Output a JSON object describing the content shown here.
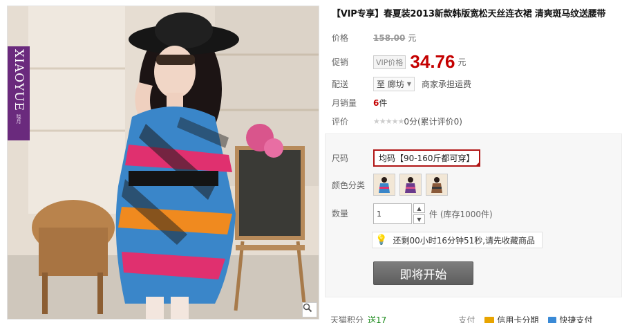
{
  "product": {
    "title": "【VIP专享】春夏装2013新款韩版宽松天丝连衣裙 清爽斑马纹送腰带",
    "brand_name": "XIAOYUE",
    "brand_sub": "晓月"
  },
  "price_row": {
    "label": "价格",
    "original": "158.00",
    "unit": "元"
  },
  "promo_row": {
    "label": "促销",
    "tag": "VIP价格",
    "price": "34.76",
    "unit": "元"
  },
  "delivery_row": {
    "label": "配送",
    "location": "至 廊坊",
    "note": "商家承担运费"
  },
  "sales_row": {
    "label": "月销量",
    "count": "6",
    "unit": "件"
  },
  "rating_row": {
    "label": "评价",
    "stars": "★★★★★",
    "text": "0分(累计评价0)"
  },
  "size_row": {
    "label": "尺码",
    "selected": "均码【90-160斤都可穿】"
  },
  "color_row": {
    "label": "颜色分类"
  },
  "quantity_row": {
    "label": "数量",
    "value": "1",
    "stock": "件 (库存1000件)"
  },
  "countdown": {
    "text": "还剩00小时16分钟51秒,请先收藏商品"
  },
  "buy_button": {
    "label": "即将开始"
  },
  "bottom": {
    "points_label": "天猫积分",
    "points_value": "送17",
    "pay_label": "支付",
    "card_pay": "信用卡分期",
    "quick_pay": "快捷支付"
  },
  "colors": {
    "price_red": "#c40000",
    "brand_purple": "#6a2a7d",
    "buy_button_gray": "#6e6e6e"
  },
  "icons": {
    "zoom": "magnifier-icon",
    "bulb": "lightbulb-icon",
    "dropdown": "chevron-down-icon"
  }
}
